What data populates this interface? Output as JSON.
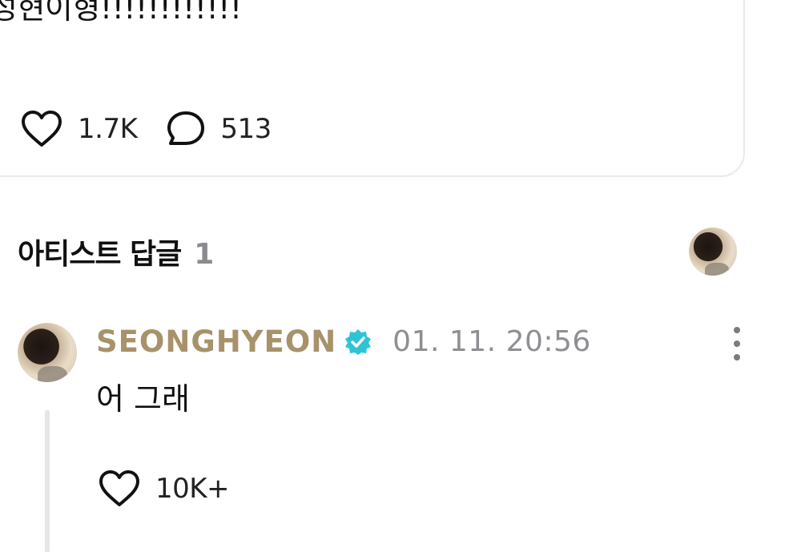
{
  "post": {
    "text": "성현이형!!!!!!!!!!!!",
    "like_count": "1.7K",
    "comment_count": "513",
    "icons": {
      "like": "heart-outline-icon",
      "comment": "speech-bubble-icon"
    }
  },
  "artist_replies": {
    "title": "아티스트 답글",
    "count": "1"
  },
  "comment": {
    "author": "SEONGHYEON",
    "author_color": "#a8926a",
    "verified_color": "#2ec4d6",
    "timestamp": "01. 11. 20:56",
    "text": "어 그래",
    "like_count": "10K+"
  }
}
